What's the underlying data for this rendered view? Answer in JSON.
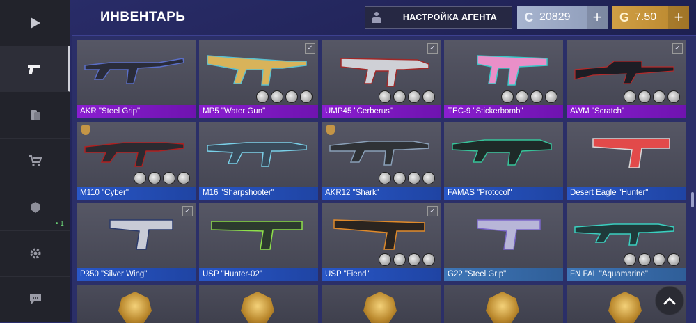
{
  "header": {
    "title": "ИНВЕНТАРЬ",
    "agent_button_label": "НАСТРОЙКА АГЕНТА",
    "silver_amount": "20829",
    "silver_icon": "C",
    "gold_amount": "7.50",
    "gold_icon": "G",
    "plus": "+"
  },
  "sidebar": {
    "items": [
      {
        "icon": "play-icon",
        "active": false
      },
      {
        "icon": "pistol-icon",
        "active": true
      },
      {
        "icon": "coins-icon",
        "active": false
      },
      {
        "icon": "cart-icon",
        "active": false
      },
      {
        "icon": "case-icon",
        "active": false,
        "badge": "• 1"
      },
      {
        "icon": "gear-icon",
        "active": false
      },
      {
        "icon": "chat-icon",
        "active": false
      }
    ]
  },
  "colors": {
    "purple": "#8a1ed0",
    "blue": "#2957c7",
    "steel": "#3f77b8",
    "gold_check": "#f0c050"
  },
  "items": [
    {
      "name": "AKR \"Steel Grip\"",
      "rarity": "purple"
    },
    {
      "name": "MP5 \"Water Gun\"",
      "rarity": "purple"
    },
    {
      "name": "UMP45 \"Cerberus\"",
      "rarity": "purple"
    },
    {
      "name": "TEC-9 \"Stickerbomb\"",
      "rarity": "purple"
    },
    {
      "name": "AWM \"Scratch\"",
      "rarity": "purple"
    },
    {
      "name": "M110 \"Cyber\"",
      "rarity": "blue"
    },
    {
      "name": "M16 \"Sharpshooter\"",
      "rarity": "blue"
    },
    {
      "name": "AKR12 \"Shark\"",
      "rarity": "blue"
    },
    {
      "name": "FAMAS \"Protocol\"",
      "rarity": "blue"
    },
    {
      "name": "Desert Eagle \"Hunter\"",
      "rarity": "blue"
    },
    {
      "name": "P350 \"Silver Wing\"",
      "rarity": "blue"
    },
    {
      "name": "USP \"Hunter-02\"",
      "rarity": "blue"
    },
    {
      "name": "USP \"Fiend\"",
      "rarity": "blue"
    },
    {
      "name": "G22 \"Steel Grip\"",
      "rarity": "steel"
    },
    {
      "name": "FN FAL \"Aquamarine\"",
      "rarity": "steel"
    }
  ],
  "check_glyph": "✓"
}
